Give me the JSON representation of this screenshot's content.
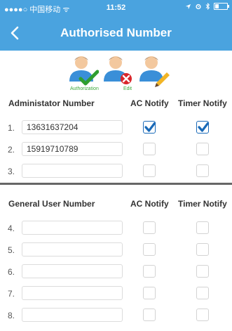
{
  "status_bar": {
    "carrier": "●●●●○ 中国移动 ᯤ",
    "time": "11:52",
    "icons": [
      "location-arrow-icon",
      "alarm-icon",
      "bluetooth-icon",
      "battery-icon"
    ],
    "battery_level": 0.3
  },
  "nav": {
    "back_icon": "‹",
    "title": "Authorised Number"
  },
  "toolbar": {
    "authorization_caption": "Authorization",
    "delete_caption": "",
    "edit_caption": "Edit"
  },
  "admin": {
    "header": "Administator Number",
    "ac_notify": "AC Notify",
    "timer_notify": "Timer Notify",
    "rows": [
      {
        "index": "1.",
        "number": "13631637204",
        "ac": true,
        "timer": true
      },
      {
        "index": "2.",
        "number": "15919710789",
        "ac": false,
        "timer": false
      },
      {
        "index": "3.",
        "number": "",
        "ac": false,
        "timer": false
      }
    ]
  },
  "general": {
    "header": "General User Number",
    "ac_notify": "AC Notify",
    "timer_notify": "Timer Notify",
    "rows": [
      {
        "index": "4.",
        "number": "",
        "ac": false,
        "timer": false
      },
      {
        "index": "5.",
        "number": "",
        "ac": false,
        "timer": false
      },
      {
        "index": "6.",
        "number": "",
        "ac": false,
        "timer": false
      },
      {
        "index": "7.",
        "number": "",
        "ac": false,
        "timer": false
      },
      {
        "index": "8.",
        "number": "",
        "ac": false,
        "timer": false
      }
    ]
  },
  "colors": {
    "header_bg": "#4aa3df",
    "check": "#1a6ab8",
    "caption_green": "#3ca83c"
  }
}
